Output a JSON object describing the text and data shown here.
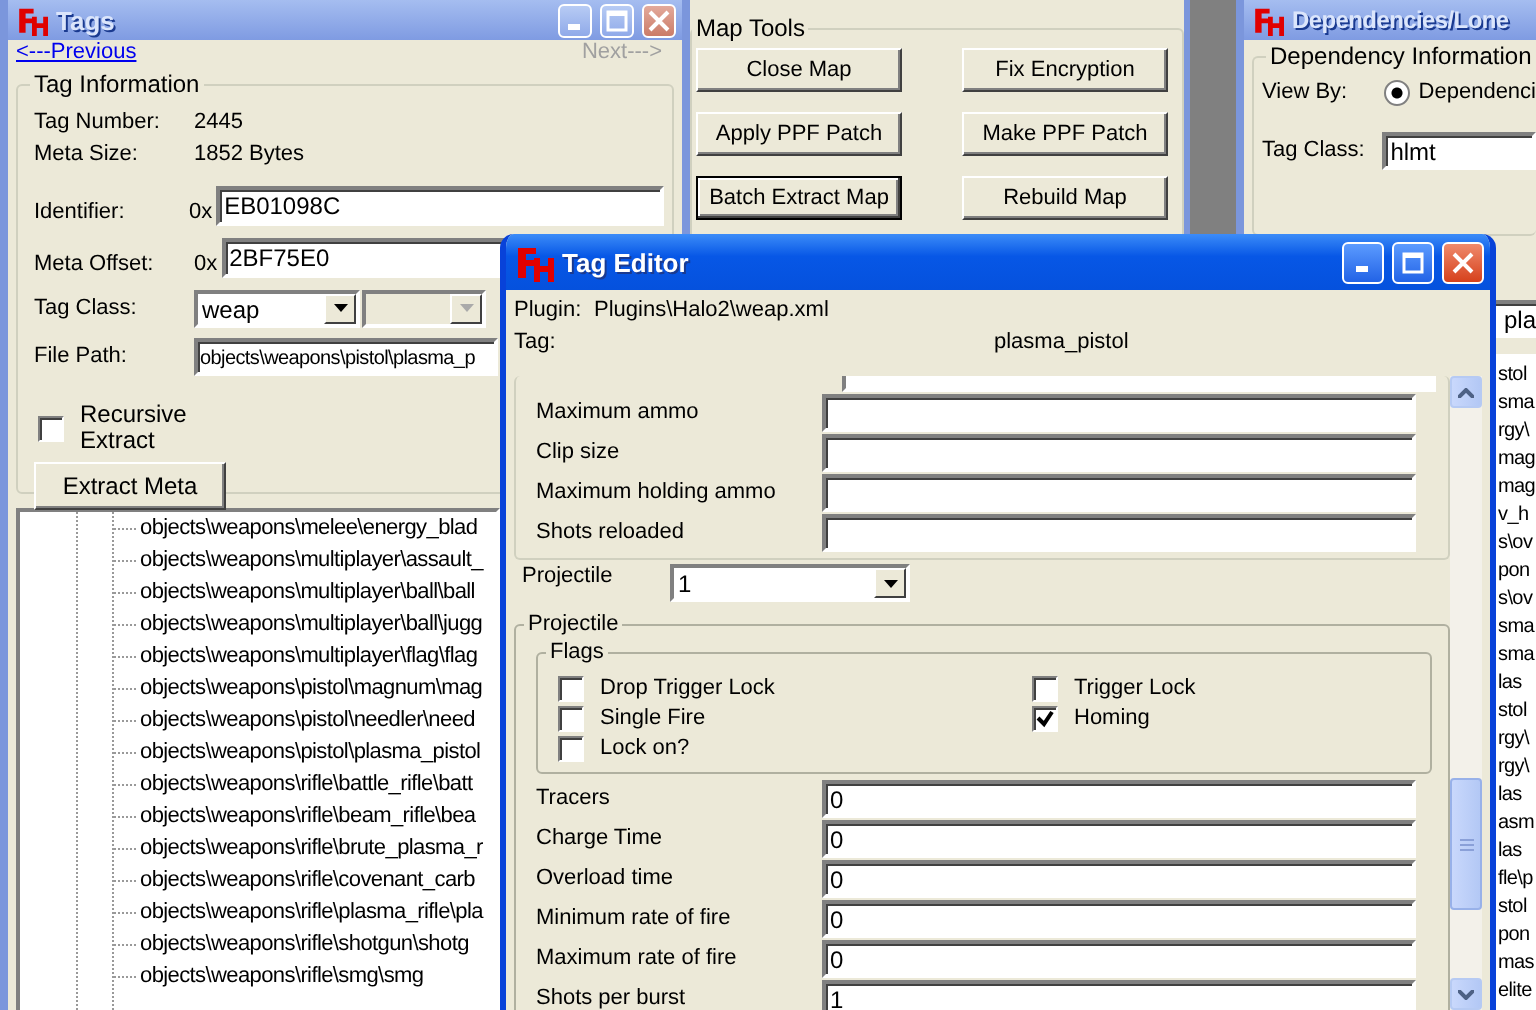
{
  "tags_window": {
    "title": "Tags",
    "active": false,
    "previous_link": {
      "label": "<---Previous",
      "disabled": false
    },
    "next_link": {
      "label": "Next--->",
      "disabled": true
    },
    "group_title": "Tag Information",
    "info": [
      {
        "label": "Tag Number:",
        "value": "2445"
      },
      {
        "label": "Meta Size:",
        "value": "1852 Bytes"
      }
    ],
    "hex_fields": [
      {
        "label": "Identifier:",
        "prefix": "0x",
        "value": "EB01098C"
      },
      {
        "label": "Meta Offset:",
        "prefix": "0x",
        "value": "2BF75E0"
      }
    ],
    "tag_class": {
      "label": "Tag Class:",
      "value": "weap"
    },
    "file_path": {
      "label": "File Path:",
      "value": "objects\\weapons\\pistol\\plasma_p"
    },
    "recursive_extract": {
      "label": "Recursive Extract",
      "checked": false
    },
    "extract_button": "Extract Meta",
    "tree_items": [
      "objects\\weapons\\melee\\energy_blad",
      "objects\\weapons\\multiplayer\\assault_",
      "objects\\weapons\\multiplayer\\ball\\ball",
      "objects\\weapons\\multiplayer\\ball\\jugg",
      "objects\\weapons\\multiplayer\\flag\\flag",
      "objects\\weapons\\pistol\\magnum\\mag",
      "objects\\weapons\\pistol\\needler\\need",
      "objects\\weapons\\pistol\\plasma_pistol",
      "objects\\weapons\\rifle\\battle_rifle\\batt",
      "objects\\weapons\\rifle\\beam_rifle\\bea",
      "objects\\weapons\\rifle\\brute_plasma_r",
      "objects\\weapons\\rifle\\covenant_carb",
      "objects\\weapons\\rifle\\plasma_rifle\\pla",
      "objects\\weapons\\rifle\\shotgun\\shotg",
      "objects\\weapons\\rifle\\smg\\smg"
    ]
  },
  "map_tools": {
    "group_title": "Map Tools",
    "buttons": [
      {
        "label": "Close Map",
        "focused": false
      },
      {
        "label": "Fix Encryption",
        "focused": false
      },
      {
        "label": "Apply PPF Patch",
        "focused": false
      },
      {
        "label": "Make PPF Patch",
        "focused": false
      },
      {
        "label": "Batch Extract Map",
        "focused": true
      },
      {
        "label": "Rebuild Map",
        "focused": false
      }
    ]
  },
  "dependencies_window": {
    "title": "Dependencies/Lone",
    "active": false,
    "group_title": "Dependency Information",
    "view_by": {
      "label": "View By:",
      "options": [
        {
          "label": "Dependenci",
          "selected": true
        }
      ]
    },
    "tag_class": {
      "label": "Tag Class:",
      "value": "hlmt"
    },
    "name_field": "pla",
    "list_items": [
      "stol",
      "sma",
      "rgy\\",
      "mag",
      "mag",
      "v_h",
      "s\\ov",
      "pon",
      "s\\ov",
      "sma",
      "sma",
      "las",
      "stol",
      "rgy\\",
      "rgy\\",
      "las",
      "asm",
      "las",
      "fle\\p",
      "stol",
      "pon",
      "mas",
      "elite"
    ]
  },
  "tag_editor": {
    "title": "Tag Editor",
    "active": true,
    "plugin": {
      "label": "Plugin:",
      "value": "Plugins\\Halo2\\weap.xml"
    },
    "tag": {
      "label": "Tag:",
      "value": "plasma_pistol"
    },
    "top_fields": [
      {
        "label": "Maximum ammo"
      },
      {
        "label": "Clip size"
      },
      {
        "label": "Maximum holding ammo"
      },
      {
        "label": "Shots reloaded"
      }
    ],
    "projectile_select": {
      "label": "Projectile",
      "value": "1"
    },
    "projectile_group": "Projectile",
    "flags_group": "Flags",
    "flags": [
      {
        "label": "Drop Trigger Lock",
        "checked": false
      },
      {
        "label": "Trigger Lock",
        "checked": false
      },
      {
        "label": "Single Fire",
        "checked": false
      },
      {
        "label": "Homing",
        "checked": true
      },
      {
        "label": "Lock on?",
        "checked": false
      }
    ],
    "fields": [
      {
        "label": "Tracers",
        "value": "0"
      },
      {
        "label": "Charge Time",
        "value": "0"
      },
      {
        "label": "Overload time",
        "value": "0"
      },
      {
        "label": "Minimum rate of fire",
        "value": "0"
      },
      {
        "label": "Maximum rate of fire",
        "value": "0"
      },
      {
        "label": "Shots per burst",
        "value": "1"
      }
    ]
  }
}
